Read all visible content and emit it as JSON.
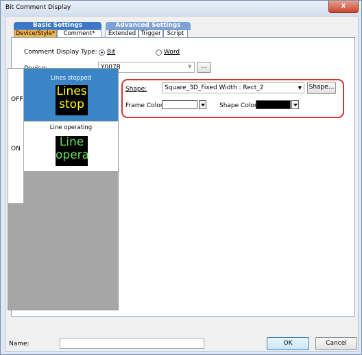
{
  "window": {
    "title": "Bit Comment Display",
    "close_glyph": "x"
  },
  "tab_groups": {
    "basic": "Basic Settings",
    "advanced": "Advanced Settings"
  },
  "tabs": {
    "device_style": "Device/Style*",
    "comment": "Comment*",
    "extended": "Extended",
    "trigger": "Trigger",
    "script": "Script"
  },
  "comment_display_type": {
    "label": "Comment Display Type:",
    "bit": "Bit",
    "word": "Word",
    "selected": "Bit"
  },
  "device": {
    "label": "Device:",
    "value": "Y007B",
    "browse": "..."
  },
  "states": {
    "off": {
      "label": "OFF",
      "comment": "Lines stopped",
      "preview_text": "Lines stop",
      "preview_color": "#ffff00",
      "header_bg": "#3a85c6"
    },
    "on": {
      "label": "ON",
      "comment": "Line operating",
      "preview_text": "Line opera",
      "preview_color": "#66e05a"
    }
  },
  "shape": {
    "label": "Shape:",
    "value": "Square_3D_Fixed Width : Rect_2",
    "button": "Shape..."
  },
  "frame_color": {
    "label": "Frame Color:",
    "value": "#ffffff"
  },
  "shape_color": {
    "label": "Shape Color:",
    "value": "#000000"
  },
  "footer": {
    "name_label": "Name:",
    "name_value": "",
    "ok": "OK",
    "cancel": "Cancel"
  },
  "icons": [
    "close-icon",
    "dropdown-arrow-icon",
    "color-dropdown-icon"
  ]
}
